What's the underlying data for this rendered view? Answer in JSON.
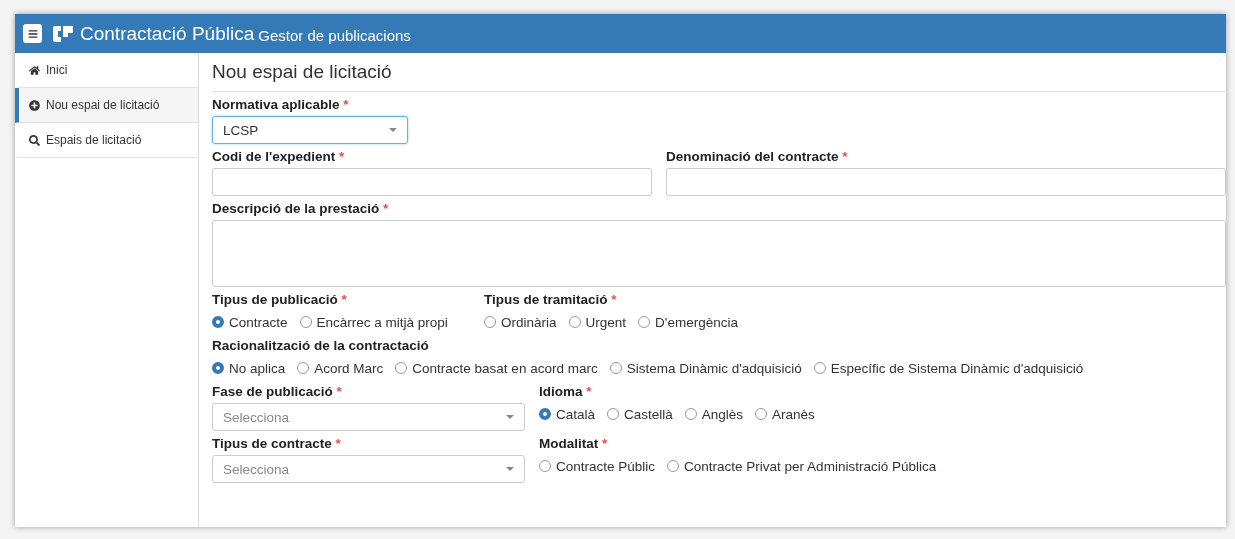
{
  "header": {
    "app_title": "Contractació Pública",
    "app_subtitle": "Gestor de publicacions"
  },
  "sidebar": {
    "items": [
      {
        "label": "Inici",
        "selected": false
      },
      {
        "label": "Nou espai de licitació",
        "selected": true
      },
      {
        "label": "Espais de licitació",
        "selected": false
      }
    ]
  },
  "page_title": "Nou espai de licitació",
  "rows": [
    {
      "fields": [
        {
          "kind": "select",
          "label": "Normativa aplicable",
          "required_mark": "*",
          "value": "LCSP",
          "focused": true
        }
      ]
    },
    {
      "fields": [
        {
          "kind": "text",
          "label": "Codi de l'expedient",
          "required_mark": "*"
        },
        {
          "kind": "text",
          "label": "Denominació del contracte",
          "required_mark": "*"
        }
      ]
    },
    {
      "fields": [
        {
          "kind": "textarea",
          "label": "Descripció de la prestació",
          "required_mark": "*"
        }
      ]
    },
    {
      "fields": [
        {
          "kind": "radio",
          "label": "Tipus de publicació",
          "required_mark": "*",
          "options": [
            {
              "label": "Contracte",
              "selected": true
            },
            {
              "label": "Encàrrec a mitjà propi",
              "selected": false
            }
          ]
        },
        {
          "kind": "radio",
          "label": "Tipus de tramitació",
          "required_mark": "*",
          "options": [
            {
              "label": "Ordinària",
              "selected": false
            },
            {
              "label": "Urgent",
              "selected": false
            },
            {
              "label": "D'emergència",
              "selected": false
            }
          ]
        }
      ]
    },
    {
      "fields": [
        {
          "kind": "radio",
          "label": "Racionalització de la contractació",
          "options": [
            {
              "label": "No aplica",
              "selected": true
            },
            {
              "label": "Acord Marc",
              "selected": false
            },
            {
              "label": "Contracte basat en acord marc",
              "selected": false
            },
            {
              "label": "Sistema Dinàmic d'adquisició",
              "selected": false
            },
            {
              "label": "Específic de Sistema Dinàmic d'adquisició",
              "selected": false
            }
          ]
        }
      ]
    },
    {
      "fields": [
        {
          "kind": "select",
          "label": "Fase de publicació",
          "required_mark": "*",
          "placeholder": "Selecciona"
        },
        {
          "kind": "radio",
          "label": "Idioma",
          "required_mark": "*",
          "options": [
            {
              "label": "Català",
              "selected": true
            },
            {
              "label": "Castellà",
              "selected": false
            },
            {
              "label": "Anglès",
              "selected": false
            },
            {
              "label": "Aranès",
              "selected": false
            }
          ]
        }
      ]
    },
    {
      "fields": [
        {
          "kind": "select",
          "label": "Tipus de contracte",
          "required_mark": "*",
          "placeholder": "Selecciona"
        },
        {
          "kind": "radio",
          "label": "Modalitat",
          "required_mark": "*",
          "options": [
            {
              "label": "Contracte Públic",
              "selected": false
            },
            {
              "label": "Contracte Privat per Administració Pública",
              "selected": false
            }
          ]
        }
      ]
    }
  ]
}
